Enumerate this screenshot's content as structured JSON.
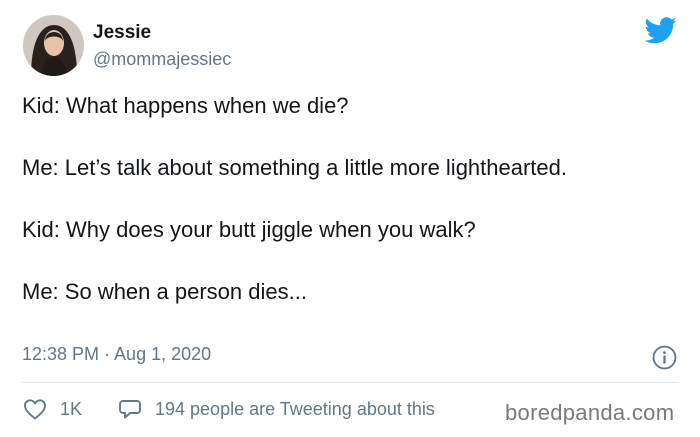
{
  "author": {
    "name": "Jessie",
    "handle": "@mommajessiec"
  },
  "tweet": {
    "paragraphs": [
      "Kid: What happens when we die?",
      "Me: Let’s talk about something a little more lighthearted.",
      "Kid: Why does your butt jiggle when you walk?",
      "Me: So when a person dies..."
    ],
    "timestamp": "12:38 PM · Aug 1, 2020"
  },
  "actions": {
    "likes": "1K",
    "tweeting": "194 people are Tweeting about this"
  },
  "watermark": "boredpanda.com",
  "colors": {
    "twitter_blue": "#1da1f2",
    "muted_text": "#657786",
    "text": "#14171a"
  },
  "icons": [
    "twitter-bird-icon",
    "info-icon",
    "heart-icon",
    "speech-bubble-icon"
  ]
}
